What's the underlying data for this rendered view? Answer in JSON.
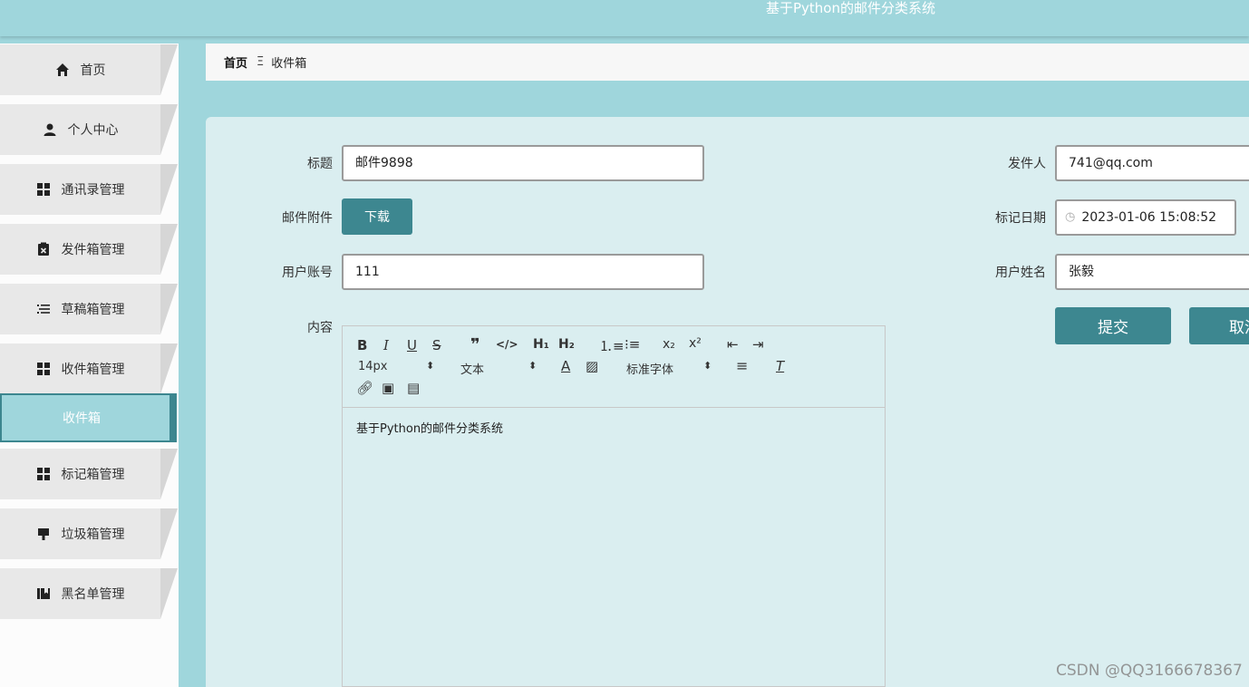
{
  "app": {
    "title": "基于Python的邮件分类系统"
  },
  "sidebar": {
    "items": [
      {
        "label": "首页",
        "icon": "home-icon"
      },
      {
        "label": "个人中心",
        "icon": "user-icon"
      },
      {
        "label": "通讯录管理",
        "icon": "grid-icon"
      },
      {
        "label": "发件箱管理",
        "icon": "clipboard-icon"
      },
      {
        "label": "草稿箱管理",
        "icon": "list-icon"
      },
      {
        "label": "收件箱管理",
        "icon": "grid-icon"
      },
      {
        "label": "标记箱管理",
        "icon": "grid-icon"
      },
      {
        "label": "垃圾箱管理",
        "icon": "brush-icon"
      },
      {
        "label": "黑名单管理",
        "icon": "book-icon"
      }
    ],
    "active_sub": "收件箱"
  },
  "breadcrumb": {
    "home": "首页",
    "separator": "Ξ",
    "current": "收件箱"
  },
  "form": {
    "title_label": "标题",
    "title_value": "邮件9898",
    "attachment_label": "邮件附件",
    "download_label": "下载",
    "account_label": "用户账号",
    "account_value": "111",
    "content_label": "内容",
    "sender_label": "发件人",
    "sender_value": "741@qq.com",
    "mark_date_label": "标记日期",
    "mark_date_value": "2023-01-06 15:08:52",
    "username_label": "用户姓名",
    "username_value": "张毅",
    "submit_label": "提交",
    "cancel_label": "取消"
  },
  "editor": {
    "font_size": "14px",
    "text_style": "文本",
    "font_family": "标准字体",
    "content": "基于Python的邮件分类系统"
  },
  "watermark": "CSDN @QQ3166678367",
  "colors": {
    "accent": "#3d8790",
    "header_bg": "#9fd6dc",
    "panel_bg": "#daeef0"
  }
}
